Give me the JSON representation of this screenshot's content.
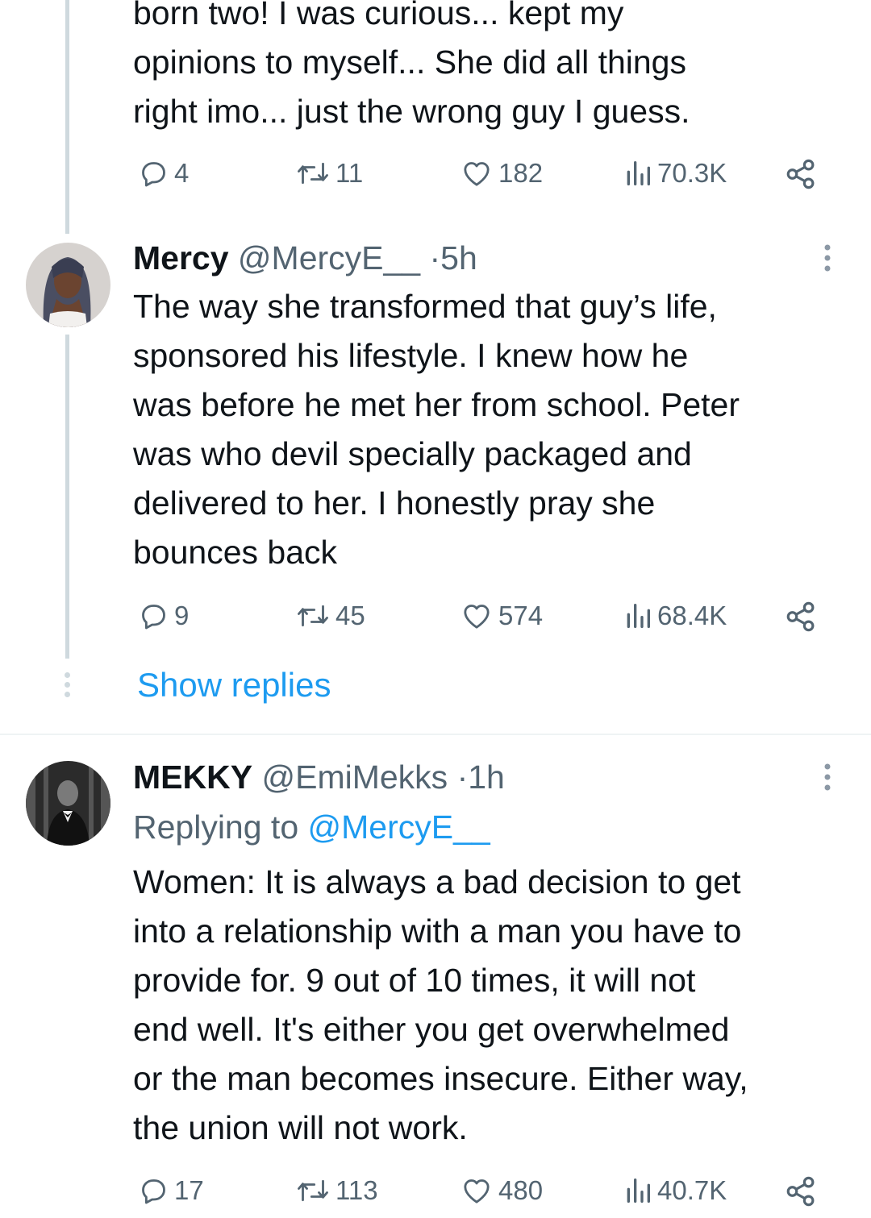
{
  "tweet_top": {
    "text": "born two! I was curious... kept my\nopinions to myself... She did all things\nright imo... just the wrong guy I guess.",
    "stats": {
      "replies": "4",
      "reposts": "11",
      "likes": "182",
      "views": "70.3K"
    }
  },
  "tweet_mercy": {
    "name": "Mercy",
    "handle": "@MercyE__",
    "separator": "·",
    "time": "5h",
    "text": "The way she transformed that guy’s life,\nsponsored his lifestyle. I knew how he\nwas before he met her from school. Peter\nwas who devil specially packaged and\ndelivered to her. I honestly pray she\nbounces back",
    "stats": {
      "replies": "9",
      "reposts": "45",
      "likes": "574",
      "views": "68.4K"
    }
  },
  "show_replies_label": "Show replies",
  "tweet_mekky": {
    "name": "MEKKY",
    "handle": "@EmiMekks",
    "separator": "·",
    "time": "1h",
    "replying_prefix": "Replying to",
    "replying_to": "@MercyE__",
    "text": "Women: It is always a bad decision to get\ninto a relationship with a man you have to\nprovide for. 9 out of 10 times, it will not\nend well. It's either you get overwhelmed\nor the man becomes insecure. Either way,\nthe union will not work.",
    "stats": {
      "replies": "17",
      "reposts": "113",
      "likes": "480",
      "views": "40.7K"
    }
  },
  "colors": {
    "text": "#0f1419",
    "secondary": "#536471",
    "link": "#1d9bf0",
    "thread_line": "#cfd9de"
  },
  "icons": [
    "reply-icon",
    "repost-icon",
    "like-icon",
    "views-icon",
    "share-icon",
    "more-icon"
  ]
}
